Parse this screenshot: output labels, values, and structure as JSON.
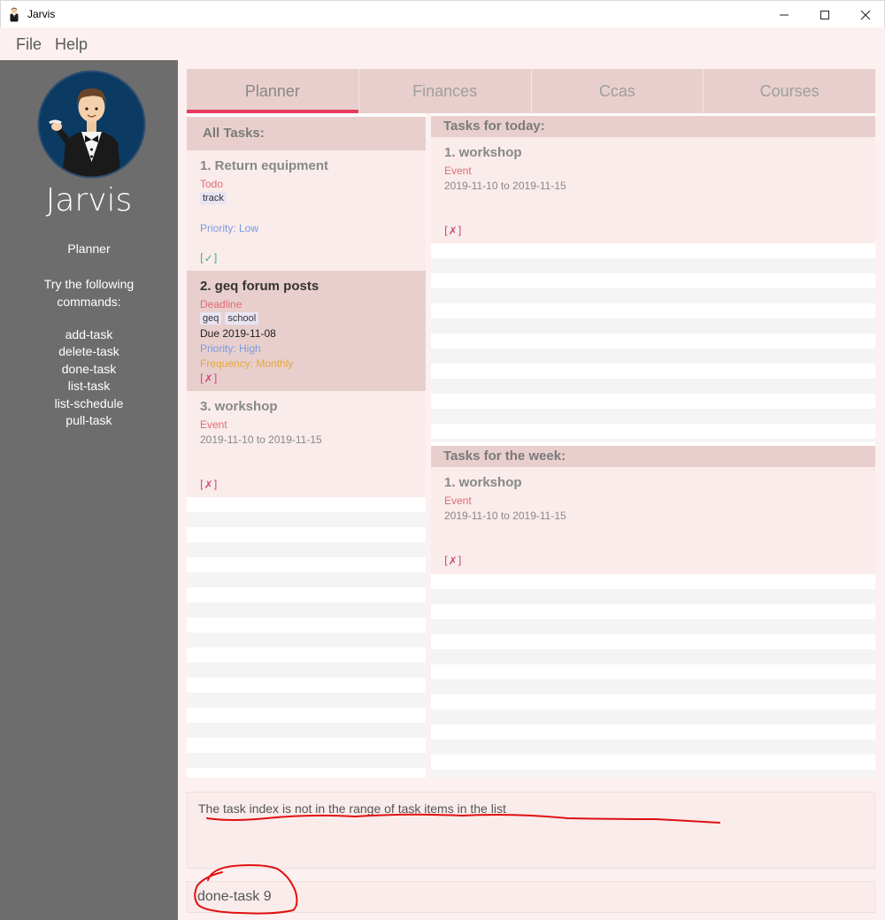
{
  "window": {
    "title": "Jarvis"
  },
  "menu": {
    "file": "File",
    "help": "Help"
  },
  "sidebar": {
    "app_name": "Jarvis",
    "section": "Planner",
    "hint": "Try the following commands:",
    "commands": [
      "add-task",
      "delete-task",
      "done-task",
      "list-task",
      "list-schedule",
      "pull-task"
    ]
  },
  "tabs": [
    "Planner",
    "Finances",
    "Ccas",
    "Courses"
  ],
  "all_tasks": {
    "header": "All Tasks:",
    "tasks": [
      {
        "title": "1. Return equipment",
        "type": "Todo",
        "tags": [
          "track"
        ],
        "priority": "Priority: Low",
        "status": "[✓]"
      },
      {
        "title": "2. geq forum posts",
        "type": "Deadline",
        "tags": [
          "geq",
          "school"
        ],
        "due": "Due 2019-11-08",
        "priority": "Priority: High",
        "frequency": "Frequency: Monthly",
        "status": "[✗]"
      },
      {
        "title": "3. workshop",
        "type": "Event",
        "dates": "2019-11-10 to 2019-11-15",
        "status": "[✗]"
      }
    ]
  },
  "today": {
    "header": "Tasks for today:",
    "task": {
      "title": "1. workshop",
      "type": "Event",
      "dates": "2019-11-10 to 2019-11-15",
      "status": "[✗]"
    }
  },
  "week": {
    "header": "Tasks for the week:",
    "task": {
      "title": "1. workshop",
      "type": "Event",
      "dates": "2019-11-10 to 2019-11-15",
      "status": "[✗]"
    }
  },
  "result": {
    "message": "The task index is not in the range of task items in the list"
  },
  "command_box": {
    "value": "done-task 9"
  },
  "colors": {
    "accent": "#e63b5c",
    "sidebar": "#6d6d6d",
    "header": "#e8cfcd",
    "card": "#f9eceb",
    "annotation": "#e01010"
  }
}
